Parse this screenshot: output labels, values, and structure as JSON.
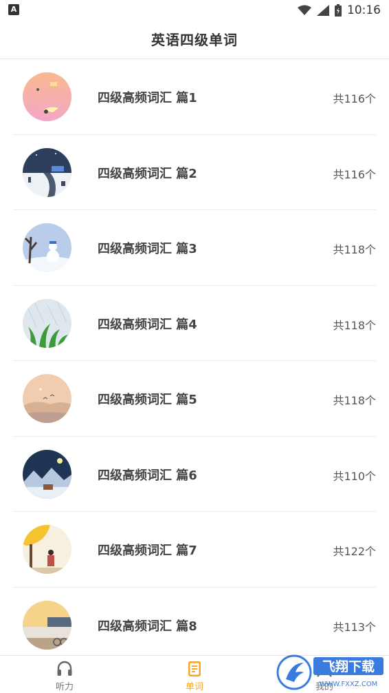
{
  "status_bar": {
    "time": "10:16"
  },
  "header": {
    "title": "英语四级单词"
  },
  "lessons": [
    {
      "title": "四级高频词汇 篇1",
      "count": "共116个"
    },
    {
      "title": "四级高频词汇 篇2",
      "count": "共116个"
    },
    {
      "title": "四级高频词汇 篇3",
      "count": "共118个"
    },
    {
      "title": "四级高频词汇 篇4",
      "count": "共118个"
    },
    {
      "title": "四级高频词汇 篇5",
      "count": "共118个"
    },
    {
      "title": "四级高频词汇 篇6",
      "count": "共110个"
    },
    {
      "title": "四级高频词汇 篇7",
      "count": "共122个"
    },
    {
      "title": "四级高频词汇 篇8",
      "count": "共113个"
    }
  ],
  "tabs": [
    {
      "label": "听力",
      "icon": "headphones-icon",
      "active": false
    },
    {
      "label": "单词",
      "icon": "book-icon",
      "active": true
    },
    {
      "label": "我的",
      "icon": "profile-icon",
      "active": false
    }
  ],
  "watermark": {
    "text": "飞翔下载",
    "sub": "WWW.FXXZ.COM"
  },
  "colors": {
    "accent": "#f5a623",
    "text": "#444444",
    "divider": "#ececec"
  }
}
